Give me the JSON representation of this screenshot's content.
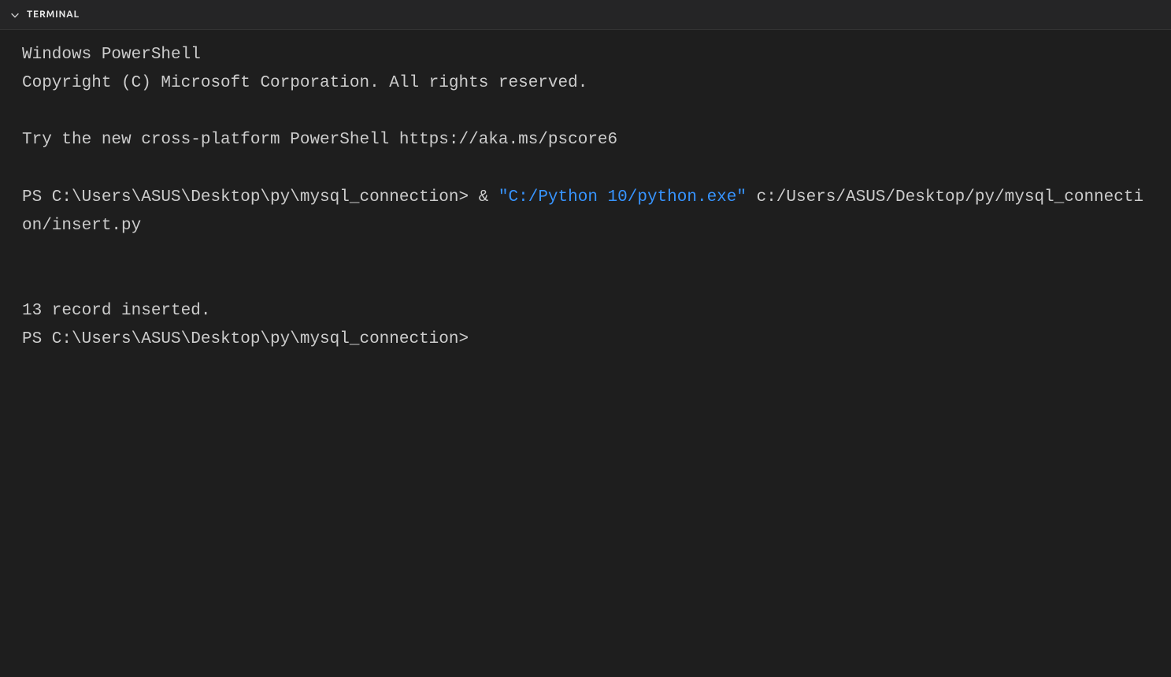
{
  "header": {
    "tab_label": "TERMINAL"
  },
  "terminal": {
    "line1": "Windows PowerShell",
    "line2": "Copyright (C) Microsoft Corporation. All rights reserved.",
    "line3": "Try the new cross-platform PowerShell https://aka.ms/pscore6",
    "prompt1": "PS C:\\Users\\ASUS\\Desktop\\py\\mysql_connection> ",
    "amp": "& ",
    "python_path": "\"C:/Python 10/python.exe\"",
    "script_arg": " c:/Users/ASUS/Desktop/py/mysql_connection/insert.py",
    "output1": "13 record inserted.",
    "prompt2": "PS C:\\Users\\ASUS\\Desktop\\py\\mysql_connection> "
  }
}
